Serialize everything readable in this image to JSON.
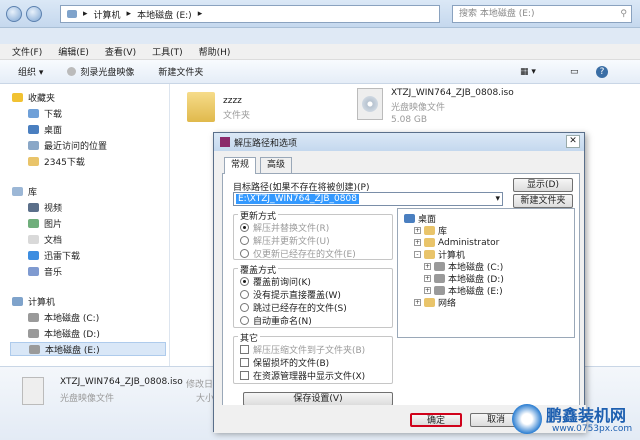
{
  "explorer": {
    "breadcrumb": [
      "计算机",
      "本地磁盘 (E:)"
    ],
    "search_placeholder": "搜索 本地磁盘 (E:)",
    "menu": [
      "文件(F)",
      "编辑(E)",
      "查看(V)",
      "工具(T)",
      "帮助(H)"
    ],
    "toolbar": {
      "organize": "组织 ▾",
      "burn": "刻录光盘映像",
      "new_folder": "新建文件夹"
    },
    "sidebar": {
      "favorites": "收藏夹",
      "fav_items": [
        "下载",
        "桌面",
        "最近访问的位置",
        "2345下载"
      ],
      "libraries": "库",
      "lib_items": [
        "视频",
        "图片",
        "文档",
        "迅雷下载",
        "音乐"
      ],
      "computer": "计算机",
      "drives": [
        "本地磁盘 (C:)",
        "本地磁盘 (D:)",
        "本地磁盘 (E:)"
      ]
    },
    "files": [
      {
        "name": "zzzz",
        "type": "文件夹"
      },
      {
        "name": "XTZJ_WIN764_ZJB_0808.iso",
        "type": "光盘映像文件",
        "size": "5.08 GB"
      }
    ],
    "status": {
      "name": "XTZJ_WIN764_ZJB_0808.iso",
      "type": "光盘映像文件",
      "modified_label": "修改日",
      "size_label": "大小"
    }
  },
  "dialog": {
    "title": "解压路径和选项",
    "tabs": [
      "常规",
      "高级"
    ],
    "target_label": "目标路径(如果不存在将被创建)(P)",
    "target_value": "E:\\XTZJ_WIN764_ZJB_0808",
    "show_btn": "显示(D)",
    "new_folder_btn": "新建文件夹(N)",
    "update_group": "更新方式",
    "update_opts": [
      "解压并替换文件(R)",
      "解压并更新文件(U)",
      "仅更新已经存在的文件(E)"
    ],
    "overwrite_group": "覆盖方式",
    "overwrite_opts": [
      "覆盖前询问(K)",
      "没有提示直接覆盖(W)",
      "跳过已经存在的文件(S)",
      "自动重命名(N)"
    ],
    "misc_group": "其它",
    "misc_opts": [
      "解压压缩文件到子文件夹(B)",
      "保留损坏的文件(B)",
      "在资源管理器中显示文件(X)"
    ],
    "save_btn": "保存设置(V)",
    "tree": [
      {
        "label": "桌面",
        "level": 0,
        "exp": ""
      },
      {
        "label": "库",
        "level": 1,
        "exp": "+"
      },
      {
        "label": "Administrator",
        "level": 1,
        "exp": "+"
      },
      {
        "label": "计算机",
        "level": 1,
        "exp": "-"
      },
      {
        "label": "本地磁盘 (C:)",
        "level": 2,
        "exp": "+"
      },
      {
        "label": "本地磁盘 (D:)",
        "level": 2,
        "exp": "+"
      },
      {
        "label": "本地磁盘 (E:)",
        "level": 2,
        "exp": "+"
      },
      {
        "label": "网络",
        "level": 1,
        "exp": "+"
      }
    ],
    "ok_btn": "确定",
    "cancel_btn": "取消"
  },
  "watermark": {
    "brand": "鹏鑫装机网",
    "url": "www.0753px.com"
  },
  "colors": {
    "accent": "#3a6ea5",
    "highlight": "#3399ff",
    "ok_border": "#d0021b"
  }
}
